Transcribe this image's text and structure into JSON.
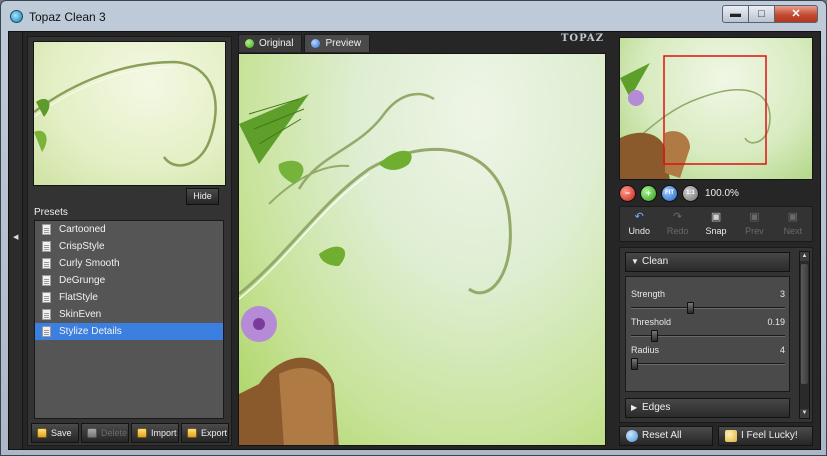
{
  "window": {
    "title": "Topaz Clean 3",
    "minimize": "▬",
    "maximize": "□",
    "close": "✕"
  },
  "left": {
    "hide_label": "Hide",
    "presets_label": "Presets",
    "presets": [
      {
        "name": "Cartooned",
        "selected": false
      },
      {
        "name": "CrispStyle",
        "selected": false
      },
      {
        "name": "Curly Smooth",
        "selected": false
      },
      {
        "name": "DeGrunge",
        "selected": false
      },
      {
        "name": "FlatStyle",
        "selected": false
      },
      {
        "name": "SkinEven",
        "selected": false
      },
      {
        "name": "Stylize Details",
        "selected": true
      }
    ],
    "buttons": {
      "save": "Save",
      "delete": "Delete",
      "import": "Import",
      "export": "Export"
    }
  },
  "center": {
    "tabs": {
      "original": "Original",
      "preview": "Preview"
    },
    "logo": "TOPAZ"
  },
  "right": {
    "zoom": {
      "out_icon": "−",
      "in_icon": "+",
      "fit_label": "FIT",
      "one_label": "1:1",
      "value": "100.0%"
    },
    "history": {
      "undo": "Undo",
      "redo": "Redo",
      "snap": "Snap",
      "prev": "Prev",
      "next": "Next"
    },
    "clean": {
      "title": "Clean",
      "strength": {
        "label": "Strength",
        "value": "3",
        "fraction": 0.38
      },
      "threshold": {
        "label": "Threshold",
        "value": "0.19",
        "fraction": 0.15
      },
      "radius": {
        "label": "Radius",
        "value": "4",
        "fraction": 0.02
      }
    },
    "edges": {
      "title": "Edges"
    },
    "footer": {
      "reset": "Reset All",
      "lucky": "I Feel Lucky!"
    }
  }
}
